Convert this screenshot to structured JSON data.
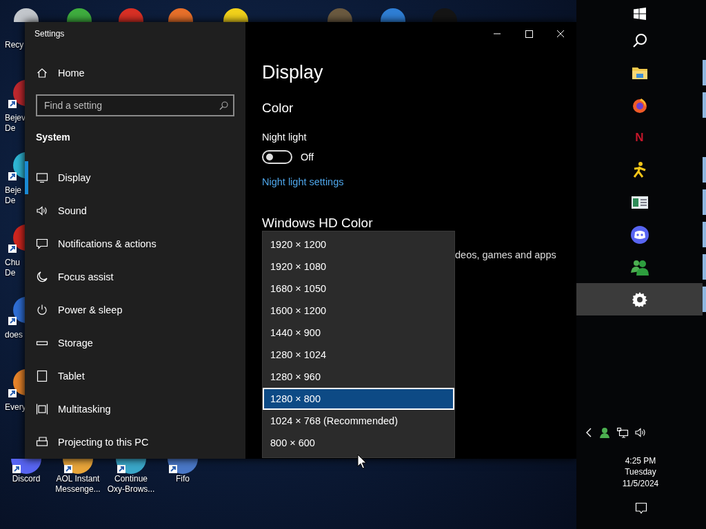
{
  "desktop": {
    "top_row": [
      {
        "label": "Recy",
        "color": "#c3c7cc"
      },
      {
        "color": "#3fae3f"
      },
      {
        "color": "#d93025"
      },
      {
        "color": "#e8702a"
      },
      {
        "color": "#f2d21b"
      },
      {
        "color": "#6b5a40"
      },
      {
        "color": "#2f7fd6"
      },
      {
        "color": "#151515"
      }
    ],
    "left_column": [
      {
        "label": "Bejev\nDe",
        "color": "#c0282e",
        "shortcut": true
      },
      {
        "label": "Beje\nDe",
        "color": "#2fb7d6",
        "shortcut": true
      },
      {
        "label": "Chu\nDe",
        "color": "#d0261f",
        "shortcut": true
      },
      {
        "label": "does",
        "color": "#2f6fd6",
        "shortcut": true
      },
      {
        "label": "Every",
        "color": "#e8842a",
        "shortcut": true
      }
    ],
    "bottom_row": [
      {
        "label": "Discord",
        "color": "#5865f2",
        "shortcut": true
      },
      {
        "label": "AOL Instant\nMessenge...",
        "color": "#e8a53a",
        "shortcut": true
      },
      {
        "label": "Continue\nOxy-Brows...",
        "color": "#3aa7c9",
        "shortcut": true
      },
      {
        "label": "Fifo",
        "color": "#4a78c8",
        "shortcut": true
      }
    ]
  },
  "window": {
    "title": "Settings",
    "sidebar": {
      "home": "Home",
      "search": {
        "placeholder": "Find a setting"
      },
      "section": "System",
      "items": [
        {
          "label": "Display",
          "kind": "monitor",
          "selected": true
        },
        {
          "label": "Sound",
          "kind": "speaker",
          "selected": false
        },
        {
          "label": "Notifications & actions",
          "kind": "message",
          "selected": false
        },
        {
          "label": "Focus assist",
          "kind": "moon",
          "selected": false
        },
        {
          "label": "Power & sleep",
          "kind": "power",
          "selected": false
        },
        {
          "label": "Storage",
          "kind": "storage",
          "selected": false
        },
        {
          "label": "Tablet",
          "kind": "tablet",
          "selected": false
        },
        {
          "label": "Multitasking",
          "kind": "multitask",
          "selected": false
        },
        {
          "label": "Projecting to this PC",
          "kind": "project",
          "selected": false
        }
      ]
    },
    "content": {
      "heading": "Display",
      "section": "Color",
      "night_light": {
        "label": "Night light",
        "on": false,
        "state": "Off"
      },
      "link": "Night light settings",
      "hd_heading": "Windows HD Color",
      "hd_text": "deos, games and apps"
    },
    "dropdown": [
      {
        "label": "1920 × 1200",
        "selected": false
      },
      {
        "label": "1920 × 1080",
        "selected": false
      },
      {
        "label": "1680 × 1050",
        "selected": false
      },
      {
        "label": "1600 × 1200",
        "selected": false
      },
      {
        "label": "1440 × 900",
        "selected": false
      },
      {
        "label": "1280 × 1024",
        "selected": false
      },
      {
        "label": "1280 × 960",
        "selected": false
      },
      {
        "label": "1280 × 800",
        "selected": true
      },
      {
        "label": "1024 × 768 (Recommended)",
        "selected": false
      },
      {
        "label": "800 × 600",
        "selected": false
      }
    ]
  },
  "taskbar": {
    "items": [
      {
        "kind": "start",
        "running": false,
        "active": false
      },
      {
        "kind": "search",
        "running": false,
        "active": false
      },
      {
        "kind": "folder",
        "running": true,
        "active": false
      },
      {
        "kind": "browser",
        "running": true,
        "active": false
      },
      {
        "kind": "letter",
        "text": "N",
        "running": false,
        "active": false
      },
      {
        "kind": "runner",
        "running": true,
        "active": false
      },
      {
        "kind": "news",
        "running": true,
        "active": false
      },
      {
        "kind": "chat",
        "running": true,
        "active": false
      },
      {
        "kind": "people",
        "running": true,
        "active": false
      },
      {
        "kind": "settings",
        "running": true,
        "active": true
      }
    ],
    "tray": [
      {
        "kind": "chevron"
      },
      {
        "kind": "user"
      },
      {
        "kind": "network"
      },
      {
        "kind": "volume"
      }
    ],
    "clock": {
      "time": "4:25 PM",
      "day": "Tuesday",
      "date": "11/5/2024"
    }
  }
}
